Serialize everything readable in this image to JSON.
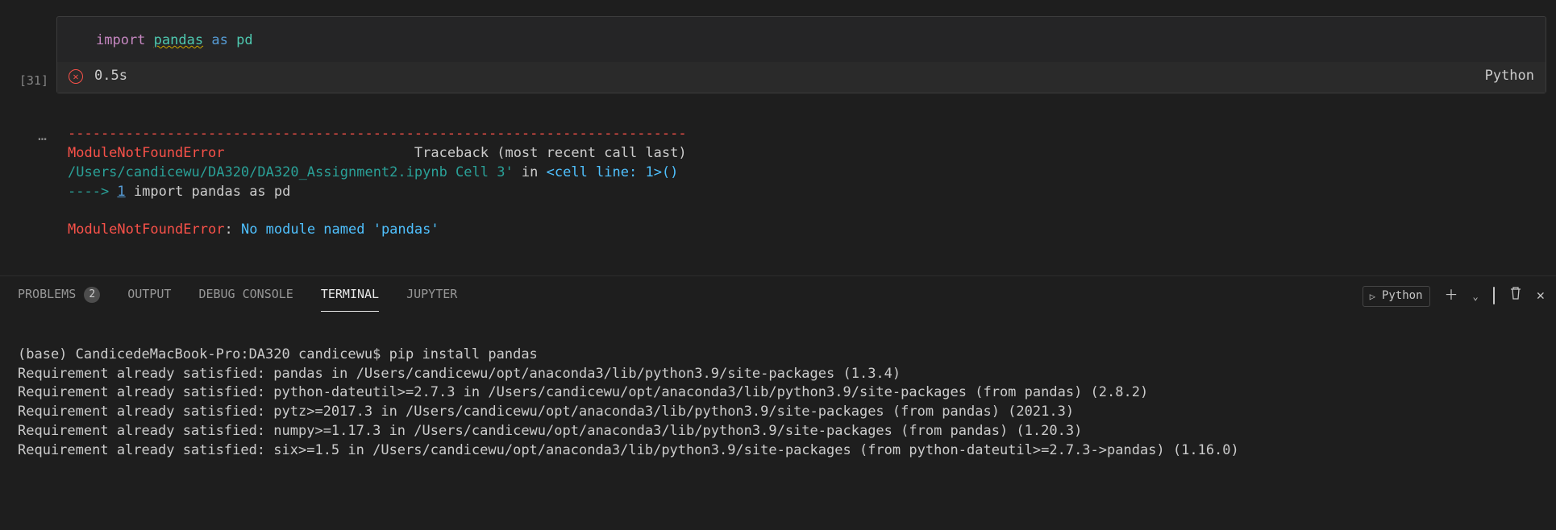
{
  "cell": {
    "exec_count_label": "[31]",
    "code": {
      "import_kw": "import",
      "module": "pandas",
      "as_kw": "as",
      "alias": "pd"
    },
    "status": {
      "duration": "0.5s",
      "kernel": "Python"
    },
    "ellipsis": "…"
  },
  "trace": {
    "separator": "---------------------------------------------------------------------------",
    "error_name": "ModuleNotFoundError",
    "header_right": "Traceback (most recent call last)",
    "file_path": "/Users/candicewu/DA320/DA320_Assignment2.ipynb Cell 3'",
    "in_word": " in ",
    "location": "<cell line: 1>()",
    "arrow": "----> ",
    "lineno": "1",
    "code_echo": " import pandas as pd",
    "final_error_name": "ModuleNotFoundError",
    "final_error_sep": ": ",
    "final_error_msg": "No module named 'pandas'"
  },
  "panel": {
    "tabs": {
      "problems": "PROBLEMS",
      "problems_badge": "2",
      "output": "OUTPUT",
      "debug": "DEBUG CONSOLE",
      "terminal": "TERMINAL",
      "jupyter": "JUPYTER"
    },
    "actions": {
      "launch_profile": "Python"
    }
  },
  "terminal": {
    "lines": [
      "(base) CandicedeMacBook-Pro:DA320 candicewu$ pip install pandas",
      "Requirement already satisfied: pandas in /Users/candicewu/opt/anaconda3/lib/python3.9/site-packages (1.3.4)",
      "Requirement already satisfied: python-dateutil>=2.7.3 in /Users/candicewu/opt/anaconda3/lib/python3.9/site-packages (from pandas) (2.8.2)",
      "Requirement already satisfied: pytz>=2017.3 in /Users/candicewu/opt/anaconda3/lib/python3.9/site-packages (from pandas) (2021.3)",
      "Requirement already satisfied: numpy>=1.17.3 in /Users/candicewu/opt/anaconda3/lib/python3.9/site-packages (from pandas) (1.20.3)",
      "Requirement already satisfied: six>=1.5 in /Users/candicewu/opt/anaconda3/lib/python3.9/site-packages (from python-dateutil>=2.7.3->pandas) (1.16.0)"
    ]
  }
}
